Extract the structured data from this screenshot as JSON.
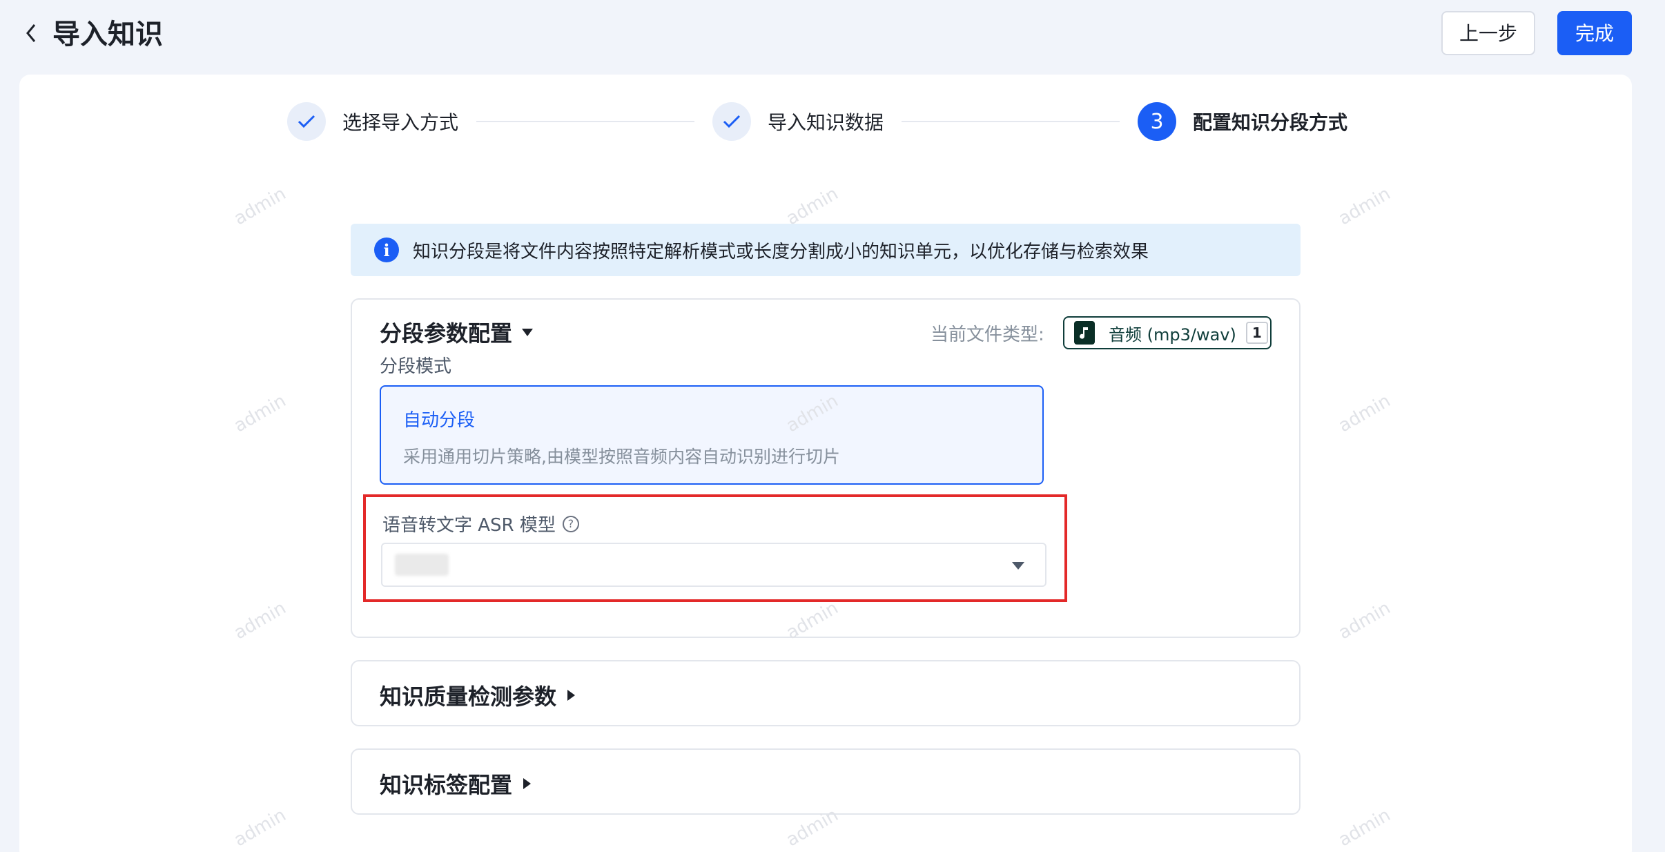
{
  "header": {
    "title": "导入知识",
    "prev_label": "上一步",
    "done_label": "完成"
  },
  "steps": [
    {
      "label": "选择导入方式",
      "status": "done"
    },
    {
      "label": "导入知识数据",
      "status": "done"
    },
    {
      "label": "配置知识分段方式",
      "status": "active",
      "number": "3"
    }
  ],
  "info": {
    "text": "知识分段是将文件内容按照特定解析模式或长度分割成小的知识单元，以优化存储与检索效果"
  },
  "config": {
    "title": "分段参数配置",
    "file_type_label": "当前文件类型:",
    "file_type_value": "音频 (mp3/wav)",
    "file_count": "1",
    "mode_label": "分段模式",
    "mode_title": "自动分段",
    "mode_desc": "采用通用切片策略,由模型按照音频内容自动识别进行切片",
    "asr_label": "语音转文字 ASR 模型"
  },
  "sections": {
    "quality_title": "知识质量检测参数",
    "tags_title": "知识标签配置"
  },
  "watermark_text": "admin",
  "colors": {
    "primary": "#1b5ef5",
    "highlight": "#e32929",
    "info_bg": "#e2f0fc"
  }
}
